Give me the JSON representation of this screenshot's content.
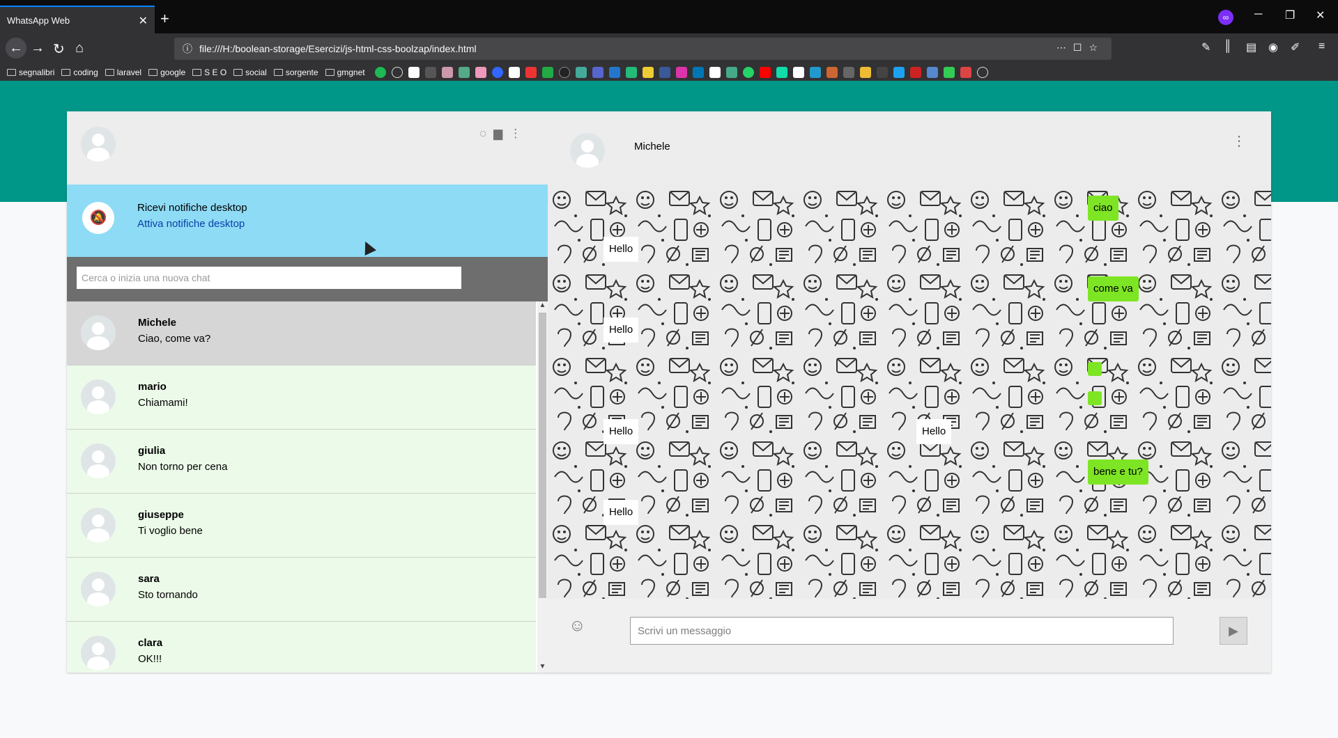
{
  "browser": {
    "tab_title": "WhatsApp Web",
    "url": "file:///H:/boolean-storage/Esercizi/js-html-css-boolzap/index.html",
    "bookmarks": [
      "segnalibri",
      "coding",
      "laravel",
      "google",
      "S E O",
      "social",
      "sorgente",
      "gmgnet"
    ],
    "colors": {
      "chrome_dark": "#0c0c0d",
      "toolbar": "#323234",
      "accent_blue": "#0a84ff"
    }
  },
  "app": {
    "colors": {
      "band": "#009688",
      "notify_bg": "#8edbf5",
      "list_bg": "#ecfbe9",
      "sent_bubble": "#7ee524"
    },
    "notify": {
      "title": "Ricevi notifiche desktop",
      "link": "Attiva notifiche desktop",
      "icon": "bell-off-icon"
    },
    "search": {
      "placeholder": "Cerca o inizia una nuova chat"
    },
    "contacts": [
      {
        "name": "Michele",
        "last": "Ciao, come va?",
        "active": true
      },
      {
        "name": "mario",
        "last": "Chiamami!"
      },
      {
        "name": "giulia",
        "last": "Non torno per cena"
      },
      {
        "name": "giuseppe",
        "last": "Ti voglio bene"
      },
      {
        "name": "sara",
        "last": "Sto tornando"
      },
      {
        "name": "clara",
        "last": "OK!!!"
      }
    ],
    "current_chat": {
      "name": "Michele",
      "messages": [
        {
          "text": "ciao",
          "type": "sent"
        },
        {
          "text": "Hello",
          "type": "received"
        },
        {
          "text": "come va",
          "type": "sent"
        },
        {
          "text": "Hello",
          "type": "received"
        },
        {
          "text": "",
          "type": "sent"
        },
        {
          "text": "",
          "type": "sent"
        },
        {
          "text": "Hello",
          "type": "received"
        },
        {
          "text": "Hello",
          "type": "received"
        },
        {
          "text": "bene e tu?",
          "type": "sent"
        },
        {
          "text": "Hello",
          "type": "received"
        }
      ]
    },
    "composer": {
      "placeholder": "Scrivi un messaggio"
    }
  }
}
